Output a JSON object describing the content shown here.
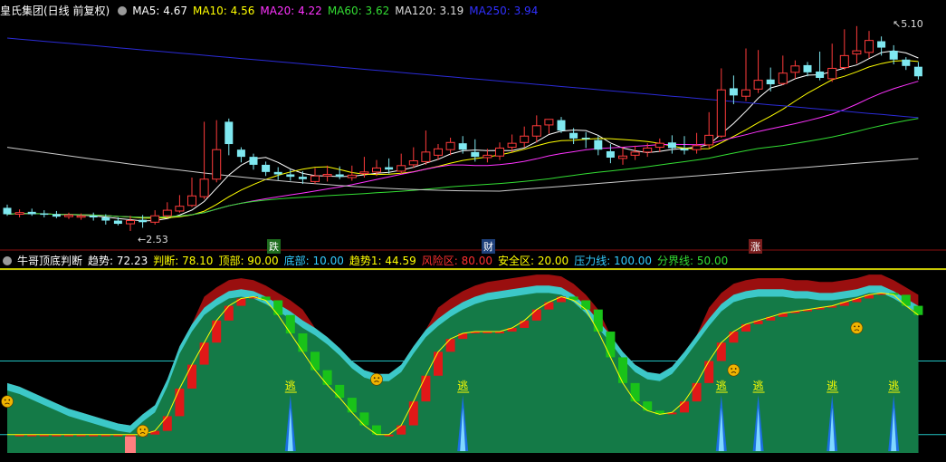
{
  "main_header": {
    "stock_name": "皇氏集团(日线 前复权)",
    "indicators": [
      {
        "label": "MA5: 4.67",
        "color": "#ffffff"
      },
      {
        "label": "MA10: 4.56",
        "color": "#ffff00"
      },
      {
        "label": "MA20: 4.22",
        "color": "#ff33ff"
      },
      {
        "label": "MA60: 3.62",
        "color": "#33dd33"
      },
      {
        "label": "MA120: 3.19",
        "color": "#dddddd"
      },
      {
        "label": "MA250: 3.94",
        "color": "#3030ff"
      }
    ]
  },
  "sub_header": {
    "indicator_name": "牛哥顶底判断",
    "values": [
      {
        "label": "趋势: 72.23",
        "color": "#ffffff"
      },
      {
        "label": "判断: 78.10",
        "color": "#ffff00"
      },
      {
        "label": "顶部: 90.00",
        "color": "#ffff00"
      },
      {
        "label": "底部: 10.00",
        "color": "#33ccff"
      },
      {
        "label": "趋势1: 44.59",
        "color": "#ffff00"
      },
      {
        "label": "风险区: 80.00",
        "color": "#ff3030"
      },
      {
        "label": "安全区: 20.00",
        "color": "#ffff00"
      },
      {
        "label": "压力线: 100.00",
        "color": "#33ccff"
      },
      {
        "label": "分界线: 50.00",
        "color": "#33dd33"
      }
    ]
  },
  "markers": {
    "high_label": "5.10",
    "low_label": "2.53",
    "event_tags": [
      {
        "text": "跌",
        "bg": "#1e6b1e"
      },
      {
        "text": "财",
        "bg": "#1e3f7a"
      },
      {
        "text": "涨",
        "bg": "#7a1e1e"
      }
    ],
    "escape_label": "逃"
  },
  "chart_data": [
    {
      "type": "candlestick",
      "title": "皇氏集团(日线 前复权)",
      "price_high": 5.1,
      "price_low": 2.53,
      "ohlc_open": [
        2.82,
        2.74,
        2.77,
        2.75,
        2.74,
        2.71,
        2.71,
        2.72,
        2.7,
        2.66,
        2.62,
        2.67,
        2.64,
        2.72,
        2.78,
        2.85,
        2.96,
        3.18,
        3.9,
        3.55,
        3.46,
        3.36,
        3.27,
        3.24,
        3.21,
        3.15,
        3.22,
        3.24,
        3.2,
        3.25,
        3.27,
        3.33,
        3.28,
        3.36,
        3.4,
        3.48,
        3.55,
        3.63,
        3.52,
        3.45,
        3.47,
        3.58,
        3.64,
        3.72,
        3.86,
        3.92,
        3.76,
        3.7,
        3.67,
        3.53,
        3.44,
        3.48,
        3.52,
        3.58,
        3.64,
        3.56,
        3.55,
        3.61,
        3.72,
        4.32,
        4.22,
        4.31,
        4.43,
        4.38,
        4.52,
        4.61,
        4.53,
        4.44,
        4.58,
        4.75,
        4.77,
        4.91,
        4.79,
        4.68,
        4.59
      ],
      "ohlc_high": [
        2.86,
        2.8,
        2.81,
        2.79,
        2.78,
        2.76,
        2.75,
        2.76,
        2.74,
        2.7,
        2.72,
        2.73,
        2.79,
        2.89,
        2.98,
        3.2,
        3.9,
        3.92,
        3.94,
        3.58,
        3.5,
        3.4,
        3.33,
        3.3,
        3.28,
        3.32,
        3.35,
        3.34,
        3.35,
        3.46,
        3.42,
        3.44,
        3.5,
        3.58,
        3.79,
        3.62,
        3.7,
        3.72,
        3.68,
        3.56,
        3.64,
        3.74,
        3.84,
        3.98,
        3.93,
        3.96,
        3.82,
        3.77,
        3.72,
        3.62,
        3.58,
        3.6,
        3.63,
        3.69,
        3.73,
        3.72,
        3.76,
        4.02,
        4.57,
        4.48,
        4.82,
        4.8,
        4.58,
        4.73,
        4.67,
        4.65,
        4.78,
        4.88,
        5.06,
        5.1,
        5.04,
        4.97,
        4.86,
        4.71,
        4.65
      ],
      "ohlc_low": [
        2.72,
        2.7,
        2.72,
        2.7,
        2.69,
        2.68,
        2.67,
        2.66,
        2.61,
        2.6,
        2.53,
        2.57,
        2.61,
        2.7,
        2.76,
        2.83,
        2.93,
        3.14,
        3.48,
        3.39,
        3.3,
        3.22,
        3.17,
        3.16,
        3.12,
        3.12,
        3.15,
        3.18,
        3.16,
        3.2,
        3.22,
        3.25,
        3.25,
        3.32,
        3.36,
        3.42,
        3.48,
        3.5,
        3.4,
        3.39,
        3.42,
        3.52,
        3.58,
        3.64,
        3.75,
        3.76,
        3.62,
        3.57,
        3.48,
        3.38,
        3.36,
        3.42,
        3.46,
        3.52,
        3.5,
        3.49,
        3.5,
        3.57,
        3.7,
        4.12,
        4.16,
        4.26,
        4.28,
        4.36,
        4.44,
        4.47,
        4.42,
        4.4,
        4.55,
        4.63,
        4.7,
        4.73,
        4.62,
        4.55,
        4.43
      ],
      "ohlc_close": [
        2.74,
        2.76,
        2.74,
        2.74,
        2.71,
        2.73,
        2.72,
        2.7,
        2.66,
        2.62,
        2.66,
        2.64,
        2.72,
        2.79,
        2.84,
        2.97,
        3.18,
        3.55,
        3.62,
        3.46,
        3.36,
        3.27,
        3.24,
        3.21,
        3.18,
        3.22,
        3.24,
        3.21,
        3.23,
        3.27,
        3.32,
        3.3,
        3.35,
        3.41,
        3.52,
        3.56,
        3.64,
        3.55,
        3.46,
        3.48,
        3.57,
        3.63,
        3.72,
        3.85,
        3.93,
        3.79,
        3.69,
        3.69,
        3.55,
        3.45,
        3.47,
        3.52,
        3.57,
        3.63,
        3.57,
        3.54,
        3.6,
        3.73,
        4.3,
        4.23,
        4.3,
        4.42,
        4.37,
        4.51,
        4.6,
        4.52,
        4.45,
        4.57,
        4.73,
        4.79,
        4.92,
        4.83,
        4.68,
        4.6,
        4.47
      ],
      "ma_lines": [
        {
          "name": "MA5",
          "value": 4.67,
          "color": "#ffffff"
        },
        {
          "name": "MA10",
          "value": 4.56,
          "color": "#ffff00"
        },
        {
          "name": "MA20",
          "value": 4.22,
          "color": "#ff33ff"
        },
        {
          "name": "MA60",
          "value": 3.62,
          "color": "#33dd33"
        },
        {
          "name": "MA120",
          "value": 3.19,
          "color": "#dddddd"
        },
        {
          "name": "MA250",
          "value": 3.94,
          "color": "#3030ff"
        }
      ]
    },
    {
      "type": "area",
      "title": "牛哥顶底判断",
      "ylim": [
        0,
        100
      ],
      "reference_lines": [
        {
          "name": "压力线",
          "value": 100
        },
        {
          "name": "顶部",
          "value": 90
        },
        {
          "name": "风险区",
          "value": 80
        },
        {
          "name": "分界线",
          "value": 50
        },
        {
          "name": "安全区",
          "value": 20
        },
        {
          "name": "底部",
          "value": 10
        }
      ],
      "trend": [
        38,
        36,
        33,
        30,
        27,
        24,
        22,
        20,
        18,
        16,
        15,
        21,
        26,
        40,
        58,
        70,
        79,
        84,
        88,
        89,
        88,
        85,
        81,
        77,
        72,
        68,
        63,
        57,
        50,
        45,
        43,
        43,
        48,
        58,
        67,
        73,
        78,
        82,
        85,
        87,
        88,
        89,
        90,
        91,
        91,
        90,
        86,
        80,
        72,
        64,
        55,
        48,
        44,
        43,
        47,
        55,
        64,
        73,
        81,
        86,
        88,
        89,
        89,
        89,
        88,
        88,
        87,
        87,
        88,
        89,
        91,
        91,
        88,
        84,
        80
      ],
      "judgment": [
        10,
        10,
        10,
        10,
        10,
        10,
        10,
        10,
        10,
        10,
        10,
        10,
        12,
        20,
        35,
        48,
        60,
        72,
        80,
        84,
        85,
        83,
        75,
        65,
        55,
        45,
        37,
        30,
        22,
        15,
        10,
        10,
        15,
        28,
        42,
        55,
        62,
        65,
        66,
        66,
        66,
        68,
        72,
        78,
        82,
        85,
        83,
        78,
        66,
        52,
        38,
        28,
        23,
        21,
        22,
        28,
        38,
        50,
        60,
        66,
        70,
        72,
        74,
        76,
        77,
        78,
        79,
        80,
        82,
        84,
        86,
        87,
        86,
        80,
        75
      ],
      "escape_signal_positions": [
        23,
        37,
        58,
        61,
        67,
        72
      ]
    }
  ]
}
